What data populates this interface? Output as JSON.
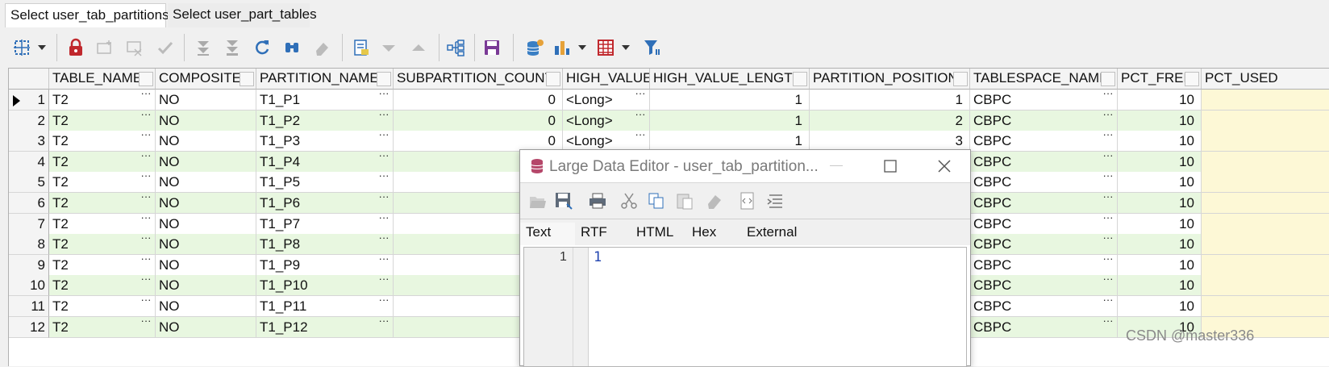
{
  "tabs": [
    {
      "label": "Select user_tab_partitions",
      "active": true
    },
    {
      "label": "Select user_part_tables",
      "active": false
    }
  ],
  "grid": {
    "columns": [
      "TABLE_NAME",
      "COMPOSITE",
      "PARTITION_NAME",
      "SUBPARTITION_COUNT",
      "HIGH_VALUE",
      "HIGH_VALUE_LENGTH",
      "PARTITION_POSITION",
      "TABLESPACE_NAME",
      "PCT_FREE",
      "PCT_USED"
    ],
    "rows": [
      {
        "n": "1",
        "table_name": "T2",
        "composite": "NO",
        "partition_name": "T1_P1",
        "subpartition_count": "0",
        "high_value": "<Long>",
        "high_value_length": "1",
        "partition_position": "1",
        "tablespace_name": "CBPC",
        "pct_free": "10",
        "pct_used": ""
      },
      {
        "n": "2",
        "table_name": "T2",
        "composite": "NO",
        "partition_name": "T1_P2",
        "subpartition_count": "0",
        "high_value": "<Long>",
        "high_value_length": "1",
        "partition_position": "2",
        "tablespace_name": "CBPC",
        "pct_free": "10",
        "pct_used": ""
      },
      {
        "n": "3",
        "table_name": "T2",
        "composite": "NO",
        "partition_name": "T1_P3",
        "subpartition_count": "0",
        "high_value": "<Long>",
        "high_value_length": "1",
        "partition_position": "3",
        "tablespace_name": "CBPC",
        "pct_free": "10",
        "pct_used": ""
      },
      {
        "n": "4",
        "table_name": "T2",
        "composite": "NO",
        "partition_name": "T1_P4",
        "subpartition_count": "",
        "high_value": "",
        "high_value_length": "",
        "partition_position": "",
        "tablespace_name": "CBPC",
        "pct_free": "10",
        "pct_used": ""
      },
      {
        "n": "5",
        "table_name": "T2",
        "composite": "NO",
        "partition_name": "T1_P5",
        "subpartition_count": "",
        "high_value": "",
        "high_value_length": "",
        "partition_position": "",
        "tablespace_name": "CBPC",
        "pct_free": "10",
        "pct_used": ""
      },
      {
        "n": "6",
        "table_name": "T2",
        "composite": "NO",
        "partition_name": "T1_P6",
        "subpartition_count": "",
        "high_value": "",
        "high_value_length": "",
        "partition_position": "",
        "tablespace_name": "CBPC",
        "pct_free": "10",
        "pct_used": ""
      },
      {
        "n": "7",
        "table_name": "T2",
        "composite": "NO",
        "partition_name": "T1_P7",
        "subpartition_count": "",
        "high_value": "",
        "high_value_length": "",
        "partition_position": "",
        "tablespace_name": "CBPC",
        "pct_free": "10",
        "pct_used": ""
      },
      {
        "n": "8",
        "table_name": "T2",
        "composite": "NO",
        "partition_name": "T1_P8",
        "subpartition_count": "",
        "high_value": "",
        "high_value_length": "",
        "partition_position": "",
        "tablespace_name": "CBPC",
        "pct_free": "10",
        "pct_used": ""
      },
      {
        "n": "9",
        "table_name": "T2",
        "composite": "NO",
        "partition_name": "T1_P9",
        "subpartition_count": "",
        "high_value": "",
        "high_value_length": "",
        "partition_position": "",
        "tablespace_name": "CBPC",
        "pct_free": "10",
        "pct_used": ""
      },
      {
        "n": "10",
        "table_name": "T2",
        "composite": "NO",
        "partition_name": "T1_P10",
        "subpartition_count": "",
        "high_value": "",
        "high_value_length": "",
        "partition_position": "",
        "tablespace_name": "CBPC",
        "pct_free": "10",
        "pct_used": ""
      },
      {
        "n": "11",
        "table_name": "T2",
        "composite": "NO",
        "partition_name": "T1_P11",
        "subpartition_count": "",
        "high_value": "",
        "high_value_length": "",
        "partition_position": "",
        "tablespace_name": "CBPC",
        "pct_free": "10",
        "pct_used": ""
      },
      {
        "n": "12",
        "table_name": "T2",
        "composite": "NO",
        "partition_name": "T1_P12",
        "subpartition_count": "",
        "high_value": "",
        "high_value_length": "",
        "partition_position": "",
        "tablespace_name": "CBPC",
        "pct_free": "10",
        "pct_used": ""
      }
    ],
    "cell_button": "···"
  },
  "dialog": {
    "title": "Large Data Editor - user_tab_partition...",
    "tabs": [
      "Text",
      "RTF",
      "HTML",
      "Hex",
      "External"
    ],
    "active_tab": "Text",
    "line_number": "1",
    "content": "1"
  },
  "watermark": "CSDN @master336",
  "colors": {
    "row_even": "#e8f7e0",
    "row_odd": "#ffffff",
    "pct_used_col": "#fdf8d6",
    "lock_red": "#c0282d",
    "icon_blue": "#2f6fb8"
  }
}
